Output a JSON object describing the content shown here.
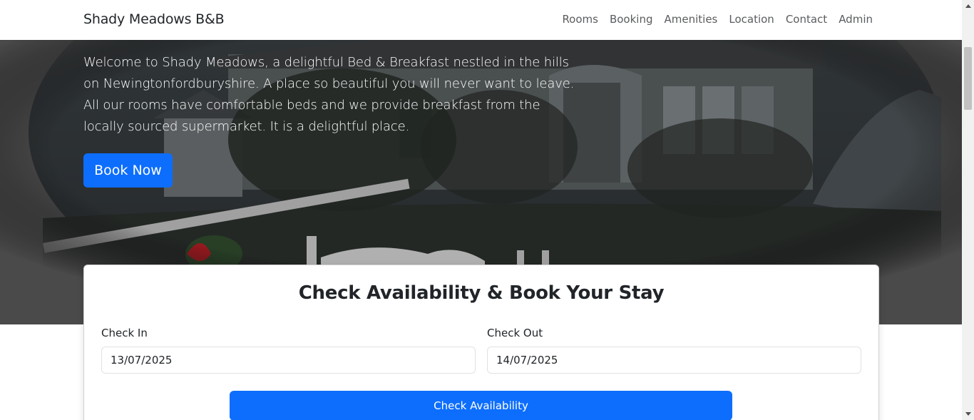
{
  "navbar": {
    "brand": "Shady Meadows B&B",
    "links": [
      "Rooms",
      "Booking",
      "Amenities",
      "Location",
      "Contact",
      "Admin"
    ]
  },
  "hero": {
    "description": "Welcome to Shady Meadows, a delightful Bed & Breakfast nestled in the hills on Newingtonfordburyshire. A place so beautiful you will never want to leave. All our rooms have comfortable beds and we provide breakfast from the locally sourced supermarket. It is a delightful place.",
    "book_button": "Book Now"
  },
  "booking": {
    "title": "Check Availability & Book Your Stay",
    "check_in_label": "Check In",
    "check_in_value": "13/07/2025",
    "check_out_label": "Check Out",
    "check_out_value": "14/07/2025",
    "submit_button": "Check Availability"
  },
  "colors": {
    "primary": "#0d6efd",
    "hero_overlay": "#585858",
    "nav_text": "#595c5f"
  },
  "icons": {
    "scroll_up": "chevron-up-icon",
    "scroll_down": "chevron-down-icon"
  }
}
